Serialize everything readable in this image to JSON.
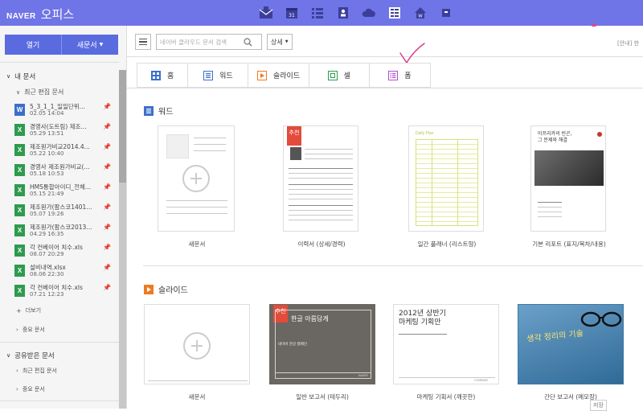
{
  "header": {
    "brand": "NAVER",
    "product": "오피스",
    "app_icons": [
      "mail-icon",
      "calendar-icon",
      "list-icon",
      "contacts-icon",
      "cloud-icon",
      "office-icon",
      "home-icon",
      "app-icon"
    ],
    "bg_color": "#6f74e6"
  },
  "sidebar": {
    "open_label": "열기",
    "new_label": "새문서",
    "my_docs_label": "내 문서",
    "recent_label": "최근 편집 문서",
    "files": [
      {
        "type": "word",
        "icon": "W",
        "name": "5_3_1_1_일일단위...",
        "date": "02.05 14:04"
      },
      {
        "type": "excel",
        "icon": "X",
        "name": "경영사(도트림) 제조...",
        "date": "05.29 13:51"
      },
      {
        "type": "excel",
        "icon": "X",
        "name": "제조원가비교2014.4...",
        "date": "05.22 10:40"
      },
      {
        "type": "excel",
        "icon": "X",
        "name": "경영사 제조원가비교(...",
        "date": "05.18 10:53"
      },
      {
        "type": "excel",
        "icon": "X",
        "name": "HMS통합아이디_전체...",
        "date": "05.15 21:49"
      },
      {
        "type": "excel",
        "icon": "X",
        "name": "제조원가(팜스코1401...",
        "date": "05.07 19:26"
      },
      {
        "type": "excel",
        "icon": "X",
        "name": "제조원가(팜스코2013...",
        "date": "04.29 16:35"
      },
      {
        "type": "excel",
        "icon": "X",
        "name": "각 컨베이어 치수.xls",
        "date": "08.07 20:29"
      },
      {
        "type": "excel",
        "icon": "X",
        "name": "설비내역.xlsx",
        "date": "08.06 22:30"
      },
      {
        "type": "excel",
        "icon": "X",
        "name": "각 컨베이어 치수.xls",
        "date": "07.21 12:23"
      }
    ],
    "more_label": "더보기",
    "important_label": "중요 문서",
    "shared_label": "공유받은 문서",
    "shared_recent_label": "최근 편집 문서",
    "shared_important_label": "중요 문서"
  },
  "toolbar": {
    "search_placeholder": "네이버 클라우드 문서 검색",
    "detail_label": "상세",
    "notice": "[안내] 한"
  },
  "tabs": [
    {
      "label": "홈",
      "icon": "home-grid-icon",
      "color": "#3d6fc9"
    },
    {
      "label": "워드",
      "icon": "word-icon",
      "color": "#3d6fc9"
    },
    {
      "label": "슬라이드",
      "icon": "slide-icon",
      "color": "#ee7a22"
    },
    {
      "label": "셀",
      "icon": "cell-icon",
      "color": "#2e9b4f"
    },
    {
      "label": "폼",
      "icon": "form-icon",
      "color": "#b04fd0"
    }
  ],
  "word_section": {
    "title": "워드",
    "cards": [
      {
        "label": "새문서"
      },
      {
        "label": "이력서 (상세/경력)",
        "badge": "추천"
      },
      {
        "label": "일간 플래너 (리스트형)",
        "thumb_title": "Daily Plan"
      },
      {
        "label": "기본 리포트 (표지/목차/내용)",
        "thumb_title": "아프리카의 빈곤,\n그 문제와 해결"
      }
    ]
  },
  "slide_section": {
    "title": "슬라이드",
    "cards": [
      {
        "label": "새문서"
      },
      {
        "label": "일반 보고서 (테두리)",
        "badge": "추천",
        "thumb_title": "한글 아름답게",
        "thumb_sub": "네이버 한글 캠페인",
        "thumb_footer": "NAVER"
      },
      {
        "label": "마케팅 기획서 (깨끗한)",
        "thumb_title": "2012년 상반기\n마케팅 기획안",
        "thumb_footer": "COMPANY"
      },
      {
        "label": "간단 보고서 (메모장)",
        "thumb_title": "생각 정리의 기술"
      }
    ]
  },
  "footer": {
    "save_label": "저장"
  }
}
